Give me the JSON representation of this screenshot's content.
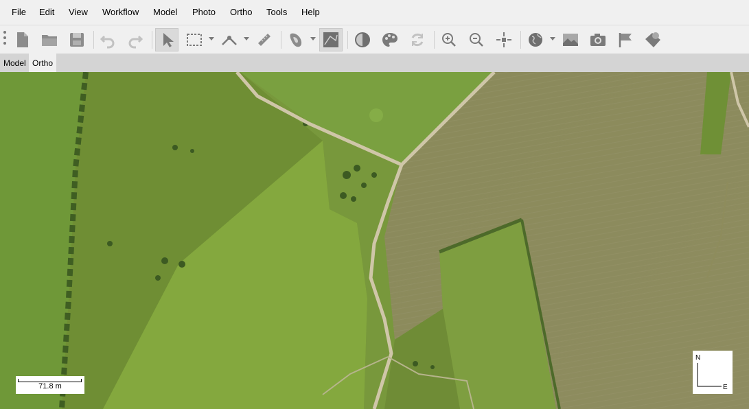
{
  "menu": [
    "File",
    "Edit",
    "View",
    "Workflow",
    "Model",
    "Photo",
    "Ortho",
    "Tools",
    "Help"
  ],
  "toolbar": {
    "buttons": [
      "new-icon",
      "open-icon",
      "save-icon",
      "undo-icon",
      "redo-icon",
      "select-arrow-icon",
      "rectangle-selection-icon",
      "draw-polyline-icon",
      "ruler-icon",
      "shape-style-icon",
      "ortho-view-icon",
      "contrast-icon",
      "palette-icon",
      "refresh-icon",
      "zoom-in-icon",
      "zoom-out-icon",
      "reset-view-icon",
      "globe-icon",
      "image-export-icon",
      "camera-icon",
      "flag-icon",
      "markers-icon"
    ]
  },
  "tabs": [
    {
      "label": "Model",
      "selected": false
    },
    {
      "label": "Ortho",
      "selected": true
    }
  ],
  "scalebar": {
    "label": "71.8 m"
  },
  "compass": {
    "north": "N",
    "east": "E"
  },
  "colors": {
    "chrome": "#f0f0f0",
    "tabbar": "#d4d4d4",
    "field_green": "#7a9a3a",
    "field_brown": "#8d8a5c",
    "road": "#cfc6a8"
  }
}
